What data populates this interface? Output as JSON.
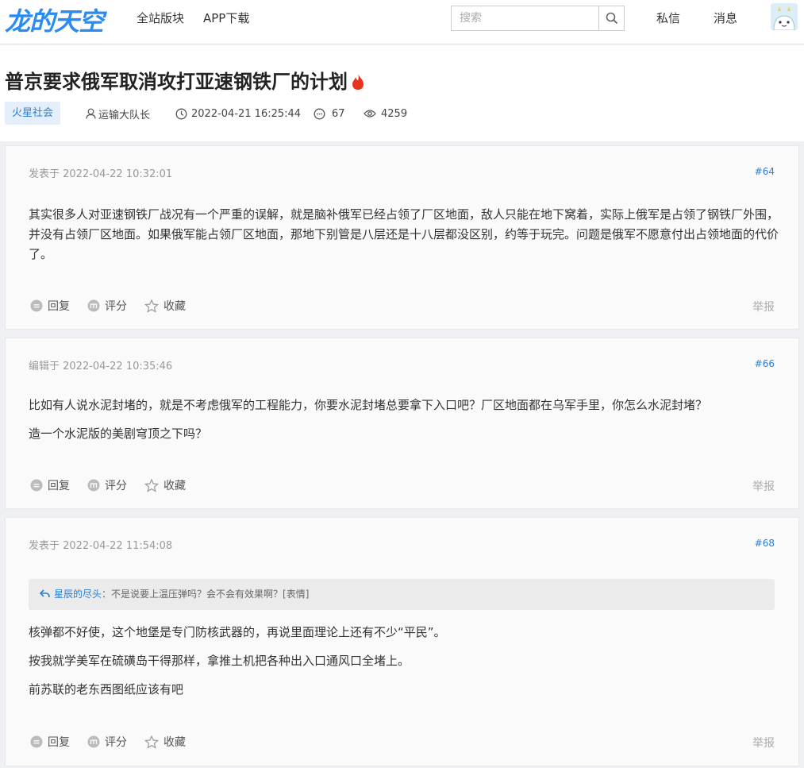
{
  "header": {
    "logo": "龙的天空",
    "nav": [
      "全站版块",
      "APP下载"
    ],
    "search_placeholder": "搜索",
    "links": [
      "私信",
      "消息"
    ]
  },
  "thread": {
    "title": "普京要求俄军取消攻打亚速钢铁厂的计划",
    "board": "火星社会",
    "author": "运输大队长",
    "datetime": "2022-04-21 16:25:44",
    "replies": "67",
    "views": "4259"
  },
  "posts": [
    {
      "time": "发表于 2022-04-22 10:32:01",
      "floor": "#64",
      "paragraphs": [
        "其实很多人对亚速钢铁厂战况有一个严重的误解，就是脑补俄军已经占领了厂区地面，敌人只能在地下窝着，实际上俄军是占领了钢铁厂外围，并没有占领厂区地面。如果俄军能占领厂区地面，那地下别管是八层还是十八层都没区别，约等于玩完。问题是俄军不愿意付出占领地面的代价了。"
      ]
    },
    {
      "time": "编辑于 2022-04-22 10:35:46",
      "floor": "#66",
      "paragraphs": [
        "比如有人说水泥封堵的，就是不考虑俄军的工程能力，你要水泥封堵总要拿下入口吧？厂区地面都在乌军手里，你怎么水泥封堵？",
        "造一个水泥版的美剧穹顶之下吗？"
      ]
    },
    {
      "time": "发表于 2022-04-22 11:54:08",
      "floor": "#68",
      "quote_name": "星辰的尽头",
      "quote_text": "：不是说要上温压弹吗？会不会有效果啊？[表情]",
      "paragraphs": [
        "核弹都不好使，这个地堡是专门防核武器的，再说里面理论上还有不少“平民”。",
        "按我就学美军在硫磺岛干得那样，拿推土机把各种出入口通风口全堵上。",
        "前苏联的老东西图纸应该有吧"
      ]
    }
  ],
  "actions": {
    "reply": "回复",
    "rate": "评分",
    "favorite": "收藏",
    "report": "举报"
  },
  "colors": {
    "accent": "#2a7fd4",
    "logo": "#2a8cf0",
    "fire": "#e8341c"
  }
}
